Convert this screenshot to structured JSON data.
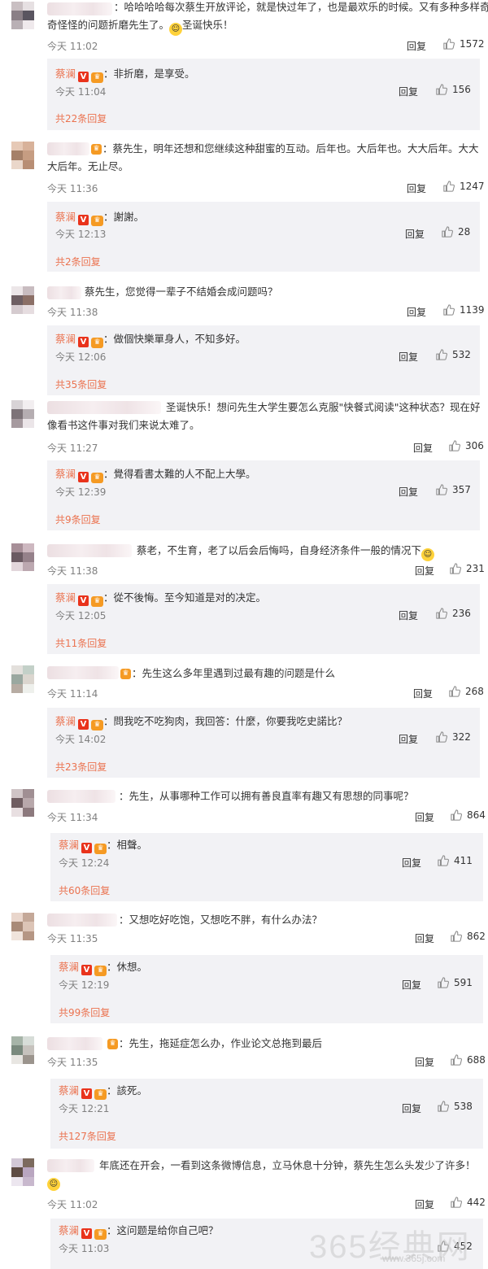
{
  "labels": {
    "reply": "回复"
  },
  "colors": {
    "accent_link": "#eb7350",
    "verified": "#e9331c",
    "crown": "#f59a23"
  },
  "comments": [
    {
      "text_part1": "：哈哈哈哈每次蔡生开放评论，就是快过年了，也是最欢乐的时候。又有多种多样奇",
      "text_part2": "奇怪怪的问题折磨先生了。",
      "text_suffix": "圣诞快乐！",
      "time": "今天 11:02",
      "likes": "1572",
      "reply": {
        "name": "蔡澜",
        "text": "：非折磨，是享受。",
        "time": "今天 11:04",
        "likes": "156",
        "more": "共22条回复"
      }
    },
    {
      "text_part1": "：蔡先生，明年还想和您继续这种甜蜜的互动。后年也。大后年也。大大后年。大大",
      "text_part2": "大后年。无止尽。",
      "time": "今天 11:36",
      "likes": "1247",
      "reply": {
        "name": "蔡澜",
        "text": "：謝謝。",
        "time": "今天 12:13",
        "likes": "28",
        "more": "共2条回复"
      }
    },
    {
      "text_part1": "蔡先生，您觉得一辈子不结婚会成问题吗？",
      "time": "今天 11:38",
      "likes": "1139",
      "reply": {
        "name": "蔡澜",
        "text": "：做個快樂單身人，不知多好。",
        "time": "今天 12:06",
        "likes": "532",
        "more": "共35条回复"
      }
    },
    {
      "text_part1": "圣诞快乐！想问先生大学生要怎么克服\"快餐式阅读\"这种状态？现在好",
      "text_part2": "像看书这件事对我们来说太难了。",
      "time": "今天 11:27",
      "likes": "306",
      "reply": {
        "name": "蔡澜",
        "text": "：覺得看書太難的人不配上大學。",
        "time": "今天 12:39",
        "likes": "357",
        "more": "共9条回复"
      }
    },
    {
      "text_part1": "蔡老，不生育，老了以后会后悔吗，自身经济条件一般的情况下",
      "time": "今天 11:38",
      "likes": "231",
      "reply": {
        "name": "蔡澜",
        "text": "：從不後悔。至今知道是对的决定。",
        "time": "今天 12:05",
        "likes": "236",
        "more": "共11条回复"
      }
    },
    {
      "text_part1": "：先生这么多年里遇到过最有趣的问题是什么",
      "time": "今天 11:14",
      "likes": "268",
      "reply": {
        "name": "蔡澜",
        "text": "：問我吃不吃狗肉，我回答：什麼，你要我吃史諾比？",
        "time": "今天 14:02",
        "likes": "322",
        "more": "共23条回复"
      }
    },
    {
      "text_part1": "：先生，从事哪种工作可以拥有善良直率有趣又有思想的同事呢？",
      "time": "今天 11:34",
      "likes": "864",
      "reply": {
        "name": "蔡澜",
        "text": "：相聲。",
        "time": "今天 12:24",
        "likes": "411",
        "more": "共60条回复"
      }
    },
    {
      "text_part1": "：又想吃好吃饱，又想吃不胖，有什么办法？",
      "time": "今天 11:35",
      "likes": "862",
      "reply": {
        "name": "蔡澜",
        "text": "：休想。",
        "time": "今天 12:19",
        "likes": "591",
        "more": "共99条回复"
      }
    },
    {
      "text_part1": "：先生，拖延症怎么办，作业论文总拖到最后",
      "time": "今天 11:35",
      "likes": "688",
      "reply": {
        "name": "蔡澜",
        "text": "：該死。",
        "time": "今天 12:21",
        "likes": "538",
        "more": "共127条回复"
      }
    },
    {
      "text_part1": "年底还在开会，一看到这条微博信息，立马休息十分钟，蔡先生怎么头发少了许多！",
      "time": "今天 11:02",
      "likes": "442",
      "reply": {
        "name": "蔡澜",
        "text": "：这问题是给你自己吧？",
        "time": "今天 11:03",
        "likes": "452",
        "more": ""
      }
    }
  ],
  "watermark": {
    "text": "365经典网",
    "url": "www.365j.com"
  }
}
